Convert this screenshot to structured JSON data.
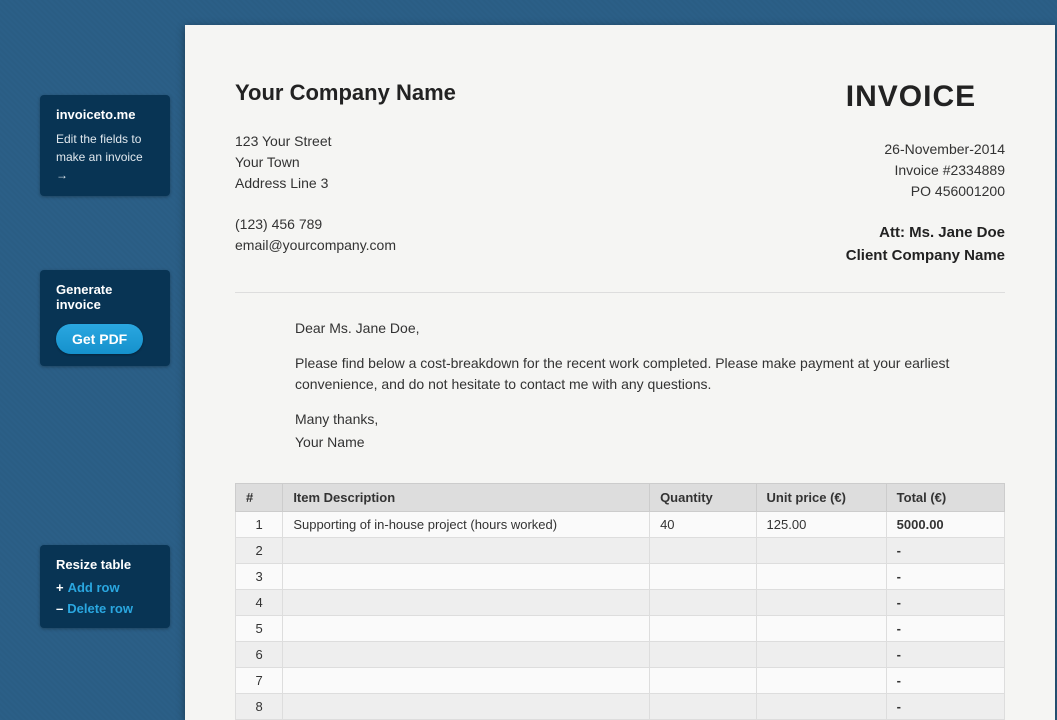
{
  "sidebar": {
    "brand": "invoiceto.me",
    "hint": "Edit the fields to make an invoice →",
    "generate_title": "Generate invoice",
    "get_pdf_label": "Get PDF",
    "resize_title": "Resize table",
    "add_row_label": "Add row",
    "delete_row_label": "Delete row"
  },
  "invoice": {
    "company_name": "Your Company Name",
    "title": "INVOICE",
    "address1": "123 Your Street",
    "address2": "Your Town",
    "address3": "Address Line 3",
    "phone": "(123) 456 789",
    "email": "email@yourcompany.com",
    "date": "26-November-2014",
    "number": "Invoice #2334889",
    "po": "PO 456001200",
    "att": "Att: Ms. Jane Doe",
    "client": "Client Company Name"
  },
  "letter": {
    "greeting": "Dear Ms. Jane Doe,",
    "body": "Please find below a cost-breakdown for the recent work completed. Please make payment at your earliest convenience, and do not hesitate to contact me with any questions.",
    "thanks": "Many thanks,",
    "signer": "Your Name"
  },
  "table": {
    "headers": {
      "num": "#",
      "desc": "Item Description",
      "qty": "Quantity",
      "unit": "Unit price (€)",
      "total": "Total (€)"
    },
    "rows": [
      {
        "n": "1",
        "desc": "Supporting of in-house project (hours worked)",
        "qty": "40",
        "unit": "125.00",
        "total": "5000.00"
      },
      {
        "n": "2",
        "desc": "",
        "qty": "",
        "unit": "",
        "total": "-"
      },
      {
        "n": "3",
        "desc": "",
        "qty": "",
        "unit": "",
        "total": "-"
      },
      {
        "n": "4",
        "desc": "",
        "qty": "",
        "unit": "",
        "total": "-"
      },
      {
        "n": "5",
        "desc": "",
        "qty": "",
        "unit": "",
        "total": "-"
      },
      {
        "n": "6",
        "desc": "",
        "qty": "",
        "unit": "",
        "total": "-"
      },
      {
        "n": "7",
        "desc": "",
        "qty": "",
        "unit": "",
        "total": "-"
      },
      {
        "n": "8",
        "desc": "",
        "qty": "",
        "unit": "",
        "total": "-"
      }
    ]
  }
}
